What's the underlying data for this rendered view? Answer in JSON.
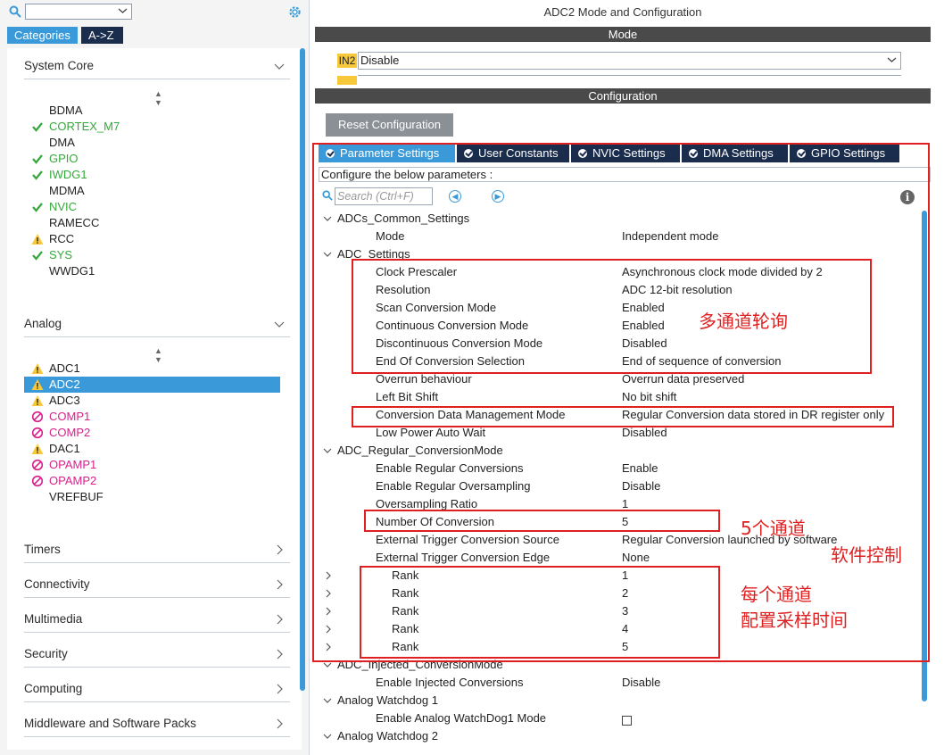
{
  "left": {
    "tabs": [
      "Categories",
      "A->Z"
    ],
    "sections": {
      "system_core": "System Core",
      "analog": "Analog",
      "timers": "Timers",
      "connectivity": "Connectivity",
      "multimedia": "Multimedia",
      "security": "Security",
      "computing": "Computing",
      "middleware": "Middleware and Software Packs"
    },
    "system_core_items": [
      {
        "label": "BDMA",
        "status": "none"
      },
      {
        "label": "CORTEX_M7",
        "status": "ok"
      },
      {
        "label": "DMA",
        "status": "none"
      },
      {
        "label": "GPIO",
        "status": "ok"
      },
      {
        "label": "IWDG1",
        "status": "ok"
      },
      {
        "label": "MDMA",
        "status": "none"
      },
      {
        "label": "NVIC",
        "status": "ok"
      },
      {
        "label": "RAMECC",
        "status": "none"
      },
      {
        "label": "RCC",
        "status": "warn"
      },
      {
        "label": "SYS",
        "status": "ok"
      },
      {
        "label": "WWDG1",
        "status": "none"
      }
    ],
    "analog_items": [
      {
        "label": "ADC1",
        "status": "warn"
      },
      {
        "label": "ADC2",
        "status": "warn",
        "selected": true
      },
      {
        "label": "ADC3",
        "status": "warn"
      },
      {
        "label": "COMP1",
        "status": "blocked"
      },
      {
        "label": "COMP2",
        "status": "blocked"
      },
      {
        "label": "DAC1",
        "status": "warn"
      },
      {
        "label": "OPAMP1",
        "status": "blocked"
      },
      {
        "label": "OPAMP2",
        "status": "blocked"
      },
      {
        "label": "VREFBUF",
        "status": "none"
      }
    ]
  },
  "right": {
    "title": "ADC2 Mode and Configuration",
    "mode_bar": "Mode",
    "in2_label": "IN2",
    "in2_value": "Disable",
    "config_bar": "Configuration",
    "reset_button": "Reset Configuration",
    "tabs": [
      "Parameter Settings",
      "User Constants",
      "NVIC Settings",
      "DMA Settings",
      "GPIO Settings"
    ],
    "configure_text": "Configure the below parameters :",
    "search_placeholder": "Search (Ctrl+F)",
    "params": {
      "g1": "ADCs_Common_Settings",
      "mode": {
        "name": "Mode",
        "value": "Independent mode"
      },
      "g2": "ADC_Settings",
      "clock": {
        "name": "Clock Prescaler",
        "value": "Asynchronous clock mode divided by 2"
      },
      "res": {
        "name": "Resolution",
        "value": "ADC 12-bit resolution"
      },
      "scan": {
        "name": "Scan Conversion Mode",
        "value": "Enabled"
      },
      "cont": {
        "name": "Continuous Conversion Mode",
        "value": "Enabled"
      },
      "disc": {
        "name": "Discontinuous Conversion Mode",
        "value": "Disabled"
      },
      "eoc": {
        "name": "End Of Conversion Selection",
        "value": "End of sequence of conversion"
      },
      "ovr": {
        "name": "Overrun behaviour",
        "value": "Overrun data preserved"
      },
      "lbs": {
        "name": "Left Bit Shift",
        "value": "No bit shift"
      },
      "cdmm": {
        "name": "Conversion Data Management Mode",
        "value": "Regular Conversion data stored in DR register only"
      },
      "lpaw": {
        "name": "Low Power Auto Wait",
        "value": "Disabled"
      },
      "g3": "ADC_Regular_ConversionMode",
      "erc": {
        "name": "Enable Regular Conversions",
        "value": "Enable"
      },
      "ero": {
        "name": "Enable Regular Oversampling",
        "value": "Disable"
      },
      "osr": {
        "name": "Oversampling Ratio",
        "value": "1"
      },
      "noc": {
        "name": "Number Of Conversion",
        "value": "5"
      },
      "etcs": {
        "name": "External Trigger Conversion Source",
        "value": "Regular Conversion launched by software"
      },
      "etce": {
        "name": "External Trigger Conversion Edge",
        "value": "None"
      },
      "ranks": [
        {
          "name": "Rank",
          "value": "1"
        },
        {
          "name": "Rank",
          "value": "2"
        },
        {
          "name": "Rank",
          "value": "3"
        },
        {
          "name": "Rank",
          "value": "4"
        },
        {
          "name": "Rank",
          "value": "5"
        }
      ],
      "g4": "ADC_Injected_ConversionMode",
      "eic": {
        "name": "Enable Injected Conversions",
        "value": "Disable"
      },
      "g5": "Analog Watchdog 1",
      "eaw": {
        "name": "Enable Analog WatchDog1 Mode"
      },
      "g6": "Analog Watchdog 2"
    },
    "annotations": {
      "multi_channel": "多通道轮询",
      "five_channels": "5个通道",
      "software_control": "软件控制",
      "per_channel": "每个通道",
      "sample_time": "配置采样时间"
    }
  },
  "colors": {
    "accent": "#3a9ad9",
    "dark_tab": "#1b2d4d",
    "ok": "#35a83b",
    "warn": "#f7c93a",
    "blocked": "#d8208c",
    "annotation": "#e02020"
  }
}
